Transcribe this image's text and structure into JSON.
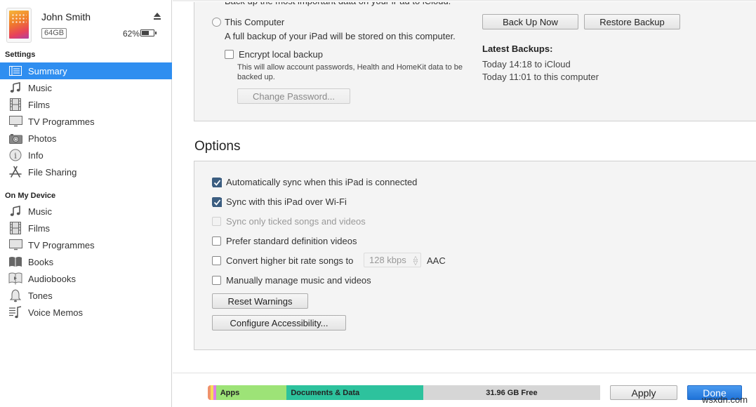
{
  "device": {
    "name": "John Smith",
    "capacity": "64GB",
    "battery_percent": "62%",
    "battery_level": 0.62
  },
  "sidebar": {
    "settings_heading": "Settings",
    "settings_items": [
      {
        "label": "Summary",
        "icon": "summary-icon",
        "active": true
      },
      {
        "label": "Music",
        "icon": "music-note-icon"
      },
      {
        "label": "Films",
        "icon": "film-icon"
      },
      {
        "label": "TV Programmes",
        "icon": "tv-icon"
      },
      {
        "label": "Photos",
        "icon": "camera-icon"
      },
      {
        "label": "Info",
        "icon": "info-icon"
      },
      {
        "label": "File Sharing",
        "icon": "app-store-icon"
      }
    ],
    "device_heading": "On My Device",
    "device_items": [
      {
        "label": "Music",
        "icon": "music-note-icon"
      },
      {
        "label": "Films",
        "icon": "film-icon"
      },
      {
        "label": "TV Programmes",
        "icon": "tv-icon"
      },
      {
        "label": "Books",
        "icon": "book-icon"
      },
      {
        "label": "Audiobooks",
        "icon": "audiobook-icon"
      },
      {
        "label": "Tones",
        "icon": "bell-icon"
      },
      {
        "label": "Voice Memos",
        "icon": "voice-memo-icon"
      }
    ]
  },
  "backups": {
    "icloud_desc_cut": "Back up the most important data on your iPad to iCloud.",
    "this_computer_label": "This Computer",
    "this_computer_desc": "A full backup of your iPad will be stored on this computer.",
    "encrypt_label": "Encrypt local backup",
    "encrypt_checked": false,
    "encrypt_desc_line1": "This will allow account passwords, Health and HomeKit data to be",
    "encrypt_desc_line2": "backed up.",
    "change_password_label": "Change Password...",
    "back_up_now_label": "Back Up Now",
    "restore_backup_label": "Restore Backup",
    "latest_heading": "Latest Backups:",
    "latest": [
      "Today 14:18 to iCloud",
      "Today 11:01 to this computer"
    ]
  },
  "options": {
    "title": "Options",
    "checkboxes": [
      {
        "label": "Automatically sync when this iPad is connected",
        "checked": true,
        "disabled": false
      },
      {
        "label": "Sync with this iPad over Wi-Fi",
        "checked": true,
        "disabled": false
      },
      {
        "label": "Sync only ticked songs and videos",
        "checked": false,
        "disabled": true
      },
      {
        "label": "Prefer standard definition videos",
        "checked": false,
        "disabled": false
      },
      {
        "label": "Convert higher bit rate songs to",
        "checked": false,
        "disabled": false
      },
      {
        "label": "Manually manage music and videos",
        "checked": false,
        "disabled": false
      }
    ],
    "bitrate_value": "128 kbps",
    "bitrate_suffix": "AAC",
    "reset_warnings_label": "Reset Warnings",
    "configure_accessibility_label": "Configure Accessibility..."
  },
  "storage": {
    "segments": [
      {
        "label": "",
        "color": "#f0926a",
        "fraction": 0.007
      },
      {
        "label": "",
        "color": "#f9d85a",
        "fraction": 0.007
      },
      {
        "label": "",
        "color": "#e07ce8",
        "fraction": 0.007
      },
      {
        "label": "Apps",
        "color": "#9de377",
        "fraction": 0.18
      },
      {
        "label": "Documents & Data",
        "color": "#2dc29d",
        "fraction": 0.348
      },
      {
        "label": "31.96 GB Free",
        "color": "#d6d6d6",
        "fraction": 0.451
      }
    ],
    "free_label": "31.96 GB Free"
  },
  "footer": {
    "apply_label": "Apply",
    "done_label": "Done"
  },
  "watermark": "wsxdn.com"
}
